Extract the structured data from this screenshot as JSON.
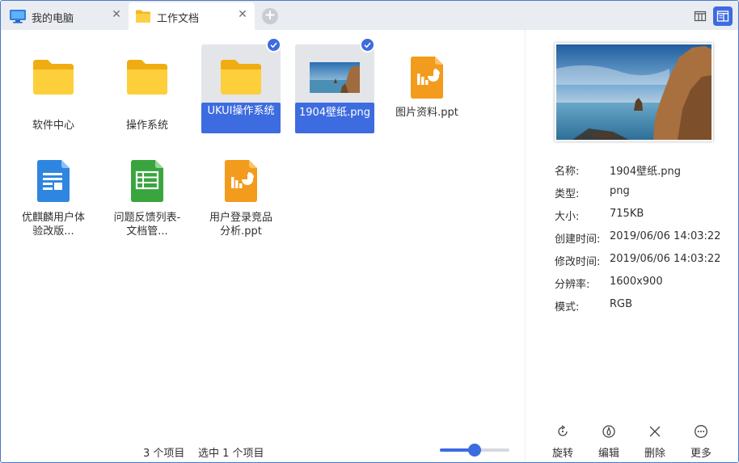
{
  "tabs": [
    {
      "label": "我的电脑",
      "icon": "computer-icon"
    },
    {
      "label": "工作文档",
      "icon": "folder-icon"
    }
  ],
  "view_buttons": [
    "column-view-icon",
    "detail-view-icon"
  ],
  "files": [
    {
      "name": "软件中心",
      "type": "folder",
      "selected": false
    },
    {
      "name": "操作系统",
      "type": "folder",
      "selected": false
    },
    {
      "name": "UKUI操作系统",
      "type": "folder",
      "selected": true
    },
    {
      "name": "1904壁纸.png",
      "type": "image",
      "selected": true
    },
    {
      "name": "图片资料.ppt",
      "type": "ppt",
      "selected": false
    },
    {
      "name": "优麒麟用户体验改版...",
      "type": "doc",
      "selected": false
    },
    {
      "name": "问题反馈列表-文档管...",
      "type": "sheet",
      "selected": false
    },
    {
      "name": "用户登录竞品分析.ppt",
      "type": "ppt",
      "selected": false
    }
  ],
  "status": {
    "count": "3 个项目",
    "selected": "选中 1 个项目",
    "zoom_level": 0.5
  },
  "details": {
    "properties": [
      {
        "key": "名称:",
        "value": "1904壁纸.png"
      },
      {
        "key": "类型:",
        "value": "png"
      },
      {
        "key": "大小:",
        "value": "715KB"
      },
      {
        "key": "创建时间:",
        "value": "2019/06/06  14:03:22"
      },
      {
        "key": "修改时间:",
        "value": "2019/06/06  14:03:22"
      },
      {
        "key": "分辨率:",
        "value": "1600x900"
      },
      {
        "key": "模式:",
        "value": "RGB"
      }
    ],
    "actions": [
      {
        "label": "旋转",
        "icon": "rotate-icon"
      },
      {
        "label": "编辑",
        "icon": "edit-icon"
      },
      {
        "label": "删除",
        "icon": "delete-icon"
      },
      {
        "label": "更多",
        "icon": "more-icon"
      }
    ]
  },
  "colors": {
    "accent": "#3d6be0",
    "folder": "#f7c531",
    "ppt": "#f39b1c",
    "doc": "#2f86e0",
    "sheet": "#3aa53e"
  }
}
